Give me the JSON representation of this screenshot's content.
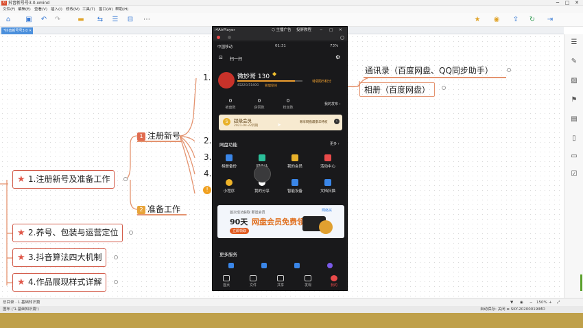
{
  "window": {
    "title": "抖音新号号3.0.xmind",
    "app_badge": "Xi"
  },
  "menubar": [
    "文件(F)",
    "编辑(E)",
    "查看(V)",
    "插入(I)",
    "修改(M)",
    "工具(T)",
    "窗口(W)",
    "帮助(H)"
  ],
  "tab": {
    "label": "*抖音新号号3.0 ✕"
  },
  "mindmap": {
    "branches": [
      {
        "label": "1.注册新号及准备工作"
      },
      {
        "label": "2.养号、包装与运营定位"
      },
      {
        "label": "3.抖音算法四大机制"
      },
      {
        "label": "4.作品展现样式详解"
      }
    ],
    "subtopics": [
      {
        "num": "1",
        "label": "注册新号",
        "color": "#e06b4f"
      },
      {
        "num": "2",
        "label": "准备工作",
        "color": "#e8a43a"
      }
    ],
    "partial_labels": [
      "1.",
      "2.",
      "3.",
      "4."
    ],
    "leaves": [
      {
        "label": "通讯录（百度网盘、QQ同步助手）"
      },
      {
        "label": "相册（百度网盘）"
      }
    ]
  },
  "airplayer": {
    "title": "i4AirPlayer",
    "links": [
      "⬡ 主播广告",
      "投屏教程"
    ],
    "status": {
      "carrier": "中国移动",
      "time": "01:31",
      "battery": "73%"
    },
    "header": {
      "scan_label": "扫一扫"
    },
    "profile": {
      "name": "微妙哥 130",
      "storage": "4522G/5140G",
      "manage": "管理空间",
      "points": "待领取5积分"
    },
    "stats": [
      {
        "value": "0",
        "label": "被盘数"
      },
      {
        "value": "0",
        "label": "获赞数"
      },
      {
        "value": "0",
        "label": "粉丝数"
      }
    ],
    "my_posts": "我的发布 ›",
    "vip": {
      "title": "超级会员",
      "date": "2021-04-22到期",
      "promo": "尊享网盘最豪华特权"
    },
    "pan": {
      "title": "网盘功能",
      "more": "更多 ›",
      "items": [
        {
          "label": "相册备份",
          "color": "#3a86e8"
        },
        {
          "label": "回收站",
          "color": "#2bbf9a"
        },
        {
          "label": "我的会员",
          "color": "#e8b12a"
        },
        {
          "label": "活动中心",
          "color": "#e84a4a"
        },
        {
          "label": "小程序",
          "color": "#f0b429"
        },
        {
          "label": "我的分享",
          "color": "#ffffff"
        },
        {
          "label": "智能设备",
          "color": "#3a86e8"
        },
        {
          "label": "文档扫描",
          "color": "#3a86e8"
        }
      ]
    },
    "banner": {
      "line1": "首次成功获取 即送会员",
      "big_num": "90天",
      "big_text": "网盘会员免费领",
      "button": "立即领取",
      "brand": "网络买"
    },
    "more_services": "更多服务",
    "bottom_nav": [
      "首页",
      "文件",
      "共享",
      "发现",
      "我的"
    ]
  },
  "statusbar": {
    "left": "总目录 · 1.基础知识篇",
    "zoom": "150%"
  },
  "statusbar2": {
    "left": "图布 ('1.基础知识篇')",
    "right": "自动保存: 关闭  ≡ SKY-20200019IMD"
  }
}
